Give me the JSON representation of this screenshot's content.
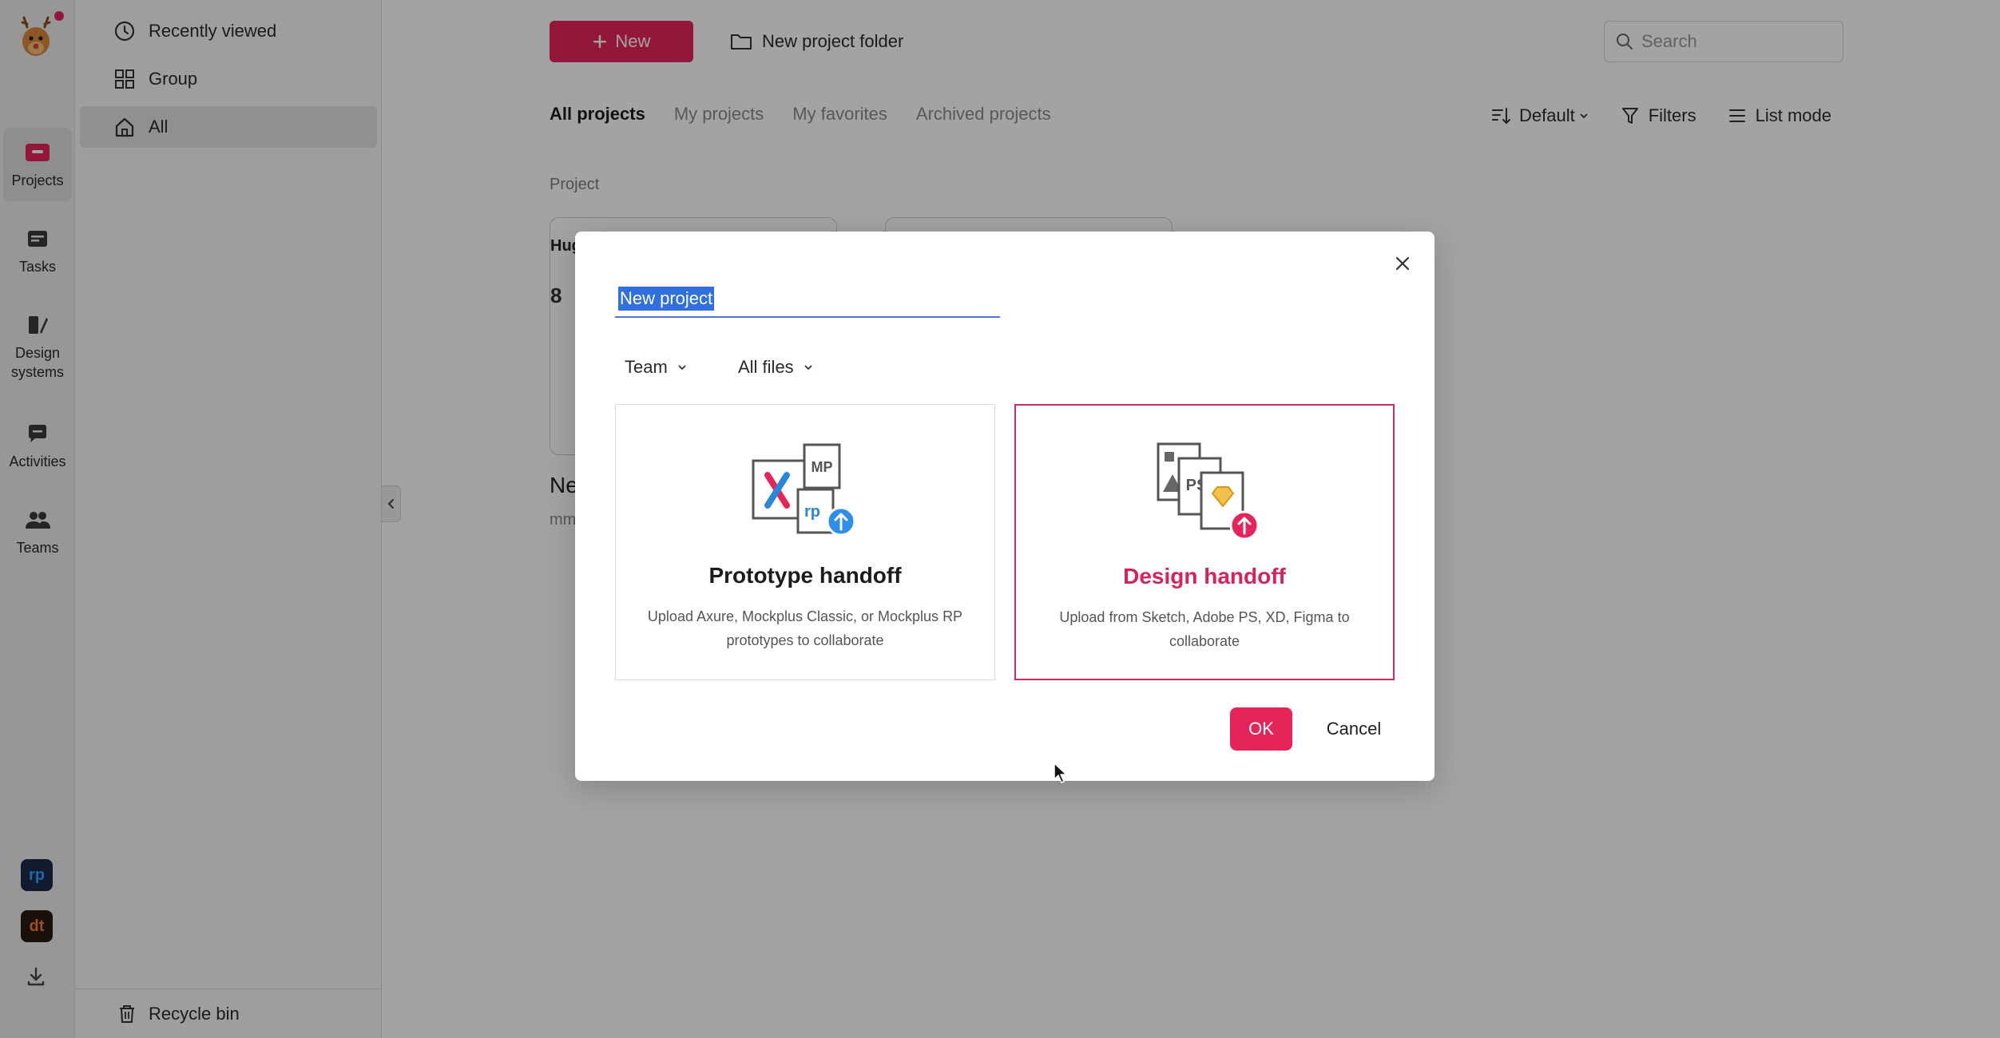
{
  "rail": {
    "items": [
      {
        "label": "Projects"
      },
      {
        "label": "Tasks"
      },
      {
        "label": "Design\nsystems"
      },
      {
        "label": "Activities"
      },
      {
        "label": "Teams"
      }
    ],
    "apps": [
      {
        "label": "rp",
        "bg": "#1b2a4a",
        "fg": "#2fa4ff"
      },
      {
        "label": "dt",
        "bg": "#2a1a12",
        "fg": "#ff7a2a"
      }
    ]
  },
  "sidebar": {
    "items": [
      {
        "label": "Recently viewed"
      },
      {
        "label": "Group"
      },
      {
        "label": "All"
      }
    ],
    "recycle_bin": "Recycle bin"
  },
  "header": {
    "new_label": "New",
    "new_folder_label": "New project folder",
    "search_placeholder": "Search"
  },
  "tabs": [
    "All projects",
    "My projects",
    "My favorites",
    "Archived projects"
  ],
  "toolbar": {
    "sort_label": "Default",
    "filters_label": "Filters",
    "list_mode_label": "List mode"
  },
  "content": {
    "section_label": "Project",
    "card_title_partial": "Hug",
    "card_number_partial": "8",
    "card_name_partial": "Ne",
    "card_sub_partial": "mm"
  },
  "modal": {
    "name_value": "New project",
    "team_dropdown": "Team",
    "files_dropdown": "All files",
    "options": [
      {
        "title": "Prototype handoff",
        "desc": "Upload Axure, Mockplus Classic, or Mockplus RP prototypes to collaborate"
      },
      {
        "title": "Design handoff",
        "desc": "Upload from Sketch, Adobe PS, XD, Figma to collaborate"
      }
    ],
    "ok_label": "OK",
    "cancel_label": "Cancel"
  },
  "colors": {
    "accent": "#e5245a",
    "selected_border": "#c6305a",
    "selection_highlight": "#2f6fde"
  }
}
